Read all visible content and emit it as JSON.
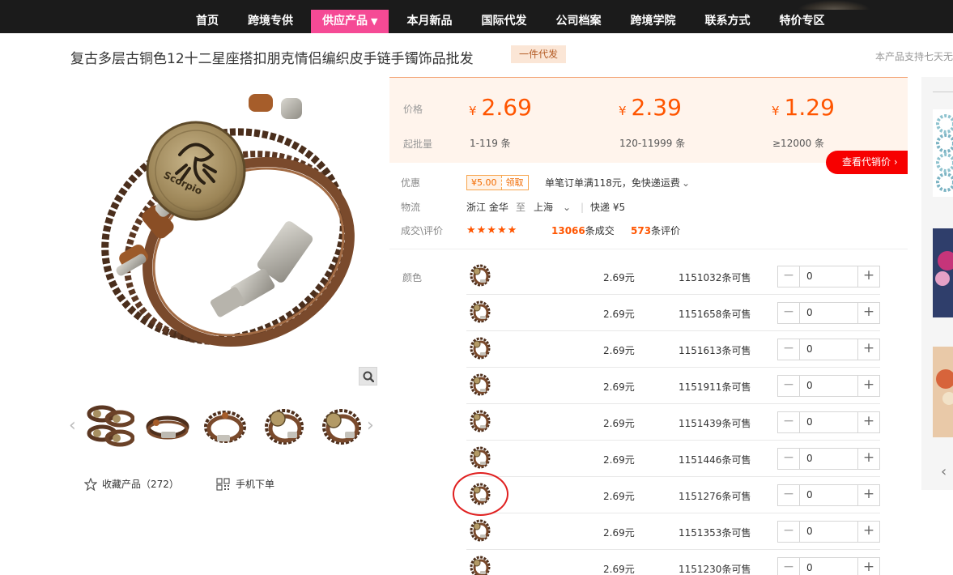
{
  "nav": {
    "items": [
      "首页",
      "跨境专供",
      "供应产品",
      "本月新品",
      "国际代发",
      "公司档案",
      "跨境学院",
      "联系方式",
      "特价专区"
    ],
    "active_caret": "▼"
  },
  "product": {
    "title": "复古多层古铜色12十二星座搭扣朋克情侣编织皮手链手镯饰品批发",
    "badge": "一件代发",
    "support_text": "本产品支持七天无"
  },
  "price": {
    "label_price": "价格",
    "label_min": "起批量",
    "currency": "¥",
    "tiers": [
      {
        "price": "2.69",
        "range": "1-119 条"
      },
      {
        "price": "2.39",
        "range": "120-11999 条"
      },
      {
        "price": "1.29",
        "range": "≥12000 条"
      }
    ],
    "agent_button": "查看代销价 ›"
  },
  "promo": {
    "label": "优惠",
    "coupon_amount": "¥5.00",
    "coupon_get": "领取",
    "text": "单笔订单满118元，免快递运费",
    "chevron": "⌄"
  },
  "logistics": {
    "label": "物流",
    "from": "浙江 金华",
    "to_word": "至",
    "to": "上海",
    "chevron": "⌄",
    "express": "快递 ¥5"
  },
  "deals": {
    "label": "成交\\评价",
    "stars": "★★★★★",
    "trades_num": "13066",
    "trades_suffix": "条成交",
    "reviews_num": "573",
    "reviews_suffix": "条评价"
  },
  "sku": {
    "label": "颜色",
    "rows": [
      {
        "price": "2.69元",
        "stock": "1151032条可售",
        "qty": "0"
      },
      {
        "price": "2.69元",
        "stock": "1151658条可售",
        "qty": "0"
      },
      {
        "price": "2.69元",
        "stock": "1151613条可售",
        "qty": "0"
      },
      {
        "price": "2.69元",
        "stock": "1151911条可售",
        "qty": "0"
      },
      {
        "price": "2.69元",
        "stock": "1151439条可售",
        "qty": "0"
      },
      {
        "price": "2.69元",
        "stock": "1151446条可售",
        "qty": "0"
      },
      {
        "price": "2.69元",
        "stock": "1151276条可售",
        "qty": "0"
      },
      {
        "price": "2.69元",
        "stock": "1151353条可售",
        "qty": "0"
      },
      {
        "price": "2.69元",
        "stock": "1151230条可售",
        "qty": "0"
      }
    ],
    "minus": "−",
    "plus": "+"
  },
  "gallery": {
    "main_image_icon": "bracelet-image",
    "zoom_icon": "magnifier-icon",
    "prev": "‹",
    "next": "›",
    "plate_text": "Scorpio"
  },
  "actions": {
    "favorite": "收藏产品（272）",
    "mobile": "手机下单"
  },
  "right_panel": {
    "arrow": "‹"
  },
  "colors": {
    "accent_orange": "#ff5500",
    "nav_active": "#f54a95",
    "agent_red": "#f70000"
  }
}
